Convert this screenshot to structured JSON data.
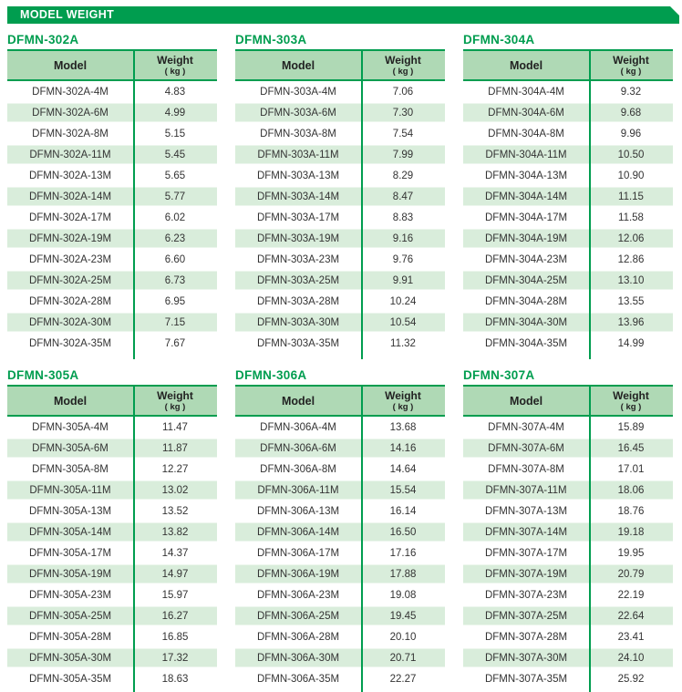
{
  "header": {
    "title": "MODEL WEIGHT"
  },
  "columns": {
    "model": "Model",
    "weight": "Weight",
    "weight_unit": "( kg )"
  },
  "colors": {
    "green": "#009D4F",
    "header_bg": "#AFD9B5",
    "row_alt": "#D9EDDB",
    "text": "#333333"
  },
  "tables": [
    {
      "title": "DFMN-302A",
      "rows": [
        {
          "model": "DFMN-302A-4M",
          "weight": "4.83"
        },
        {
          "model": "DFMN-302A-6M",
          "weight": "4.99"
        },
        {
          "model": "DFMN-302A-8M",
          "weight": "5.15"
        },
        {
          "model": "DFMN-302A-11M",
          "weight": "5.45"
        },
        {
          "model": "DFMN-302A-13M",
          "weight": "5.65"
        },
        {
          "model": "DFMN-302A-14M",
          "weight": "5.77"
        },
        {
          "model": "DFMN-302A-17M",
          "weight": "6.02"
        },
        {
          "model": "DFMN-302A-19M",
          "weight": "6.23"
        },
        {
          "model": "DFMN-302A-23M",
          "weight": "6.60"
        },
        {
          "model": "DFMN-302A-25M",
          "weight": "6.73"
        },
        {
          "model": "DFMN-302A-28M",
          "weight": "6.95"
        },
        {
          "model": "DFMN-302A-30M",
          "weight": "7.15"
        },
        {
          "model": "DFMN-302A-35M",
          "weight": "7.67"
        }
      ]
    },
    {
      "title": "DFMN-303A",
      "rows": [
        {
          "model": "DFMN-303A-4M",
          "weight": "7.06"
        },
        {
          "model": "DFMN-303A-6M",
          "weight": "7.30"
        },
        {
          "model": "DFMN-303A-8M",
          "weight": "7.54"
        },
        {
          "model": "DFMN-303A-11M",
          "weight": "7.99"
        },
        {
          "model": "DFMN-303A-13M",
          "weight": "8.29"
        },
        {
          "model": "DFMN-303A-14M",
          "weight": "8.47"
        },
        {
          "model": "DFMN-303A-17M",
          "weight": "8.83"
        },
        {
          "model": "DFMN-303A-19M",
          "weight": "9.16"
        },
        {
          "model": "DFMN-303A-23M",
          "weight": "9.76"
        },
        {
          "model": "DFMN-303A-25M",
          "weight": "9.91"
        },
        {
          "model": "DFMN-303A-28M",
          "weight": "10.24"
        },
        {
          "model": "DFMN-303A-30M",
          "weight": "10.54"
        },
        {
          "model": "DFMN-303A-35M",
          "weight": "11.32"
        }
      ]
    },
    {
      "title": "DFMN-304A",
      "rows": [
        {
          "model": "DFMN-304A-4M",
          "weight": "9.32"
        },
        {
          "model": "DFMN-304A-6M",
          "weight": "9.68"
        },
        {
          "model": "DFMN-304A-8M",
          "weight": "9.96"
        },
        {
          "model": "DFMN-304A-11M",
          "weight": "10.50"
        },
        {
          "model": "DFMN-304A-13M",
          "weight": "10.90"
        },
        {
          "model": "DFMN-304A-14M",
          "weight": "11.15"
        },
        {
          "model": "DFMN-304A-17M",
          "weight": "11.58"
        },
        {
          "model": "DFMN-304A-19M",
          "weight": "12.06"
        },
        {
          "model": "DFMN-304A-23M",
          "weight": "12.86"
        },
        {
          "model": "DFMN-304A-25M",
          "weight": "13.10"
        },
        {
          "model": "DFMN-304A-28M",
          "weight": "13.55"
        },
        {
          "model": "DFMN-304A-30M",
          "weight": "13.96"
        },
        {
          "model": "DFMN-304A-35M",
          "weight": "14.99"
        }
      ]
    },
    {
      "title": "DFMN-305A",
      "rows": [
        {
          "model": "DFMN-305A-4M",
          "weight": "11.47"
        },
        {
          "model": "DFMN-305A-6M",
          "weight": "11.87"
        },
        {
          "model": "DFMN-305A-8M",
          "weight": "12.27"
        },
        {
          "model": "DFMN-305A-11M",
          "weight": "13.02"
        },
        {
          "model": "DFMN-305A-13M",
          "weight": "13.52"
        },
        {
          "model": "DFMN-305A-14M",
          "weight": "13.82"
        },
        {
          "model": "DFMN-305A-17M",
          "weight": "14.37"
        },
        {
          "model": "DFMN-305A-19M",
          "weight": "14.97"
        },
        {
          "model": "DFMN-305A-23M",
          "weight": "15.97"
        },
        {
          "model": "DFMN-305A-25M",
          "weight": "16.27"
        },
        {
          "model": "DFMN-305A-28M",
          "weight": "16.85"
        },
        {
          "model": "DFMN-305A-30M",
          "weight": "17.32"
        },
        {
          "model": "DFMN-305A-35M",
          "weight": "18.63"
        }
      ]
    },
    {
      "title": "DFMN-306A",
      "rows": [
        {
          "model": "DFMN-306A-4M",
          "weight": "13.68"
        },
        {
          "model": "DFMN-306A-6M",
          "weight": "14.16"
        },
        {
          "model": "DFMN-306A-8M",
          "weight": "14.64"
        },
        {
          "model": "DFMN-306A-11M",
          "weight": "15.54"
        },
        {
          "model": "DFMN-306A-13M",
          "weight": "16.14"
        },
        {
          "model": "DFMN-306A-14M",
          "weight": "16.50"
        },
        {
          "model": "DFMN-306A-17M",
          "weight": "17.16"
        },
        {
          "model": "DFMN-306A-19M",
          "weight": "17.88"
        },
        {
          "model": "DFMN-306A-23M",
          "weight": "19.08"
        },
        {
          "model": "DFMN-306A-25M",
          "weight": "19.45"
        },
        {
          "model": "DFMN-306A-28M",
          "weight": "20.10"
        },
        {
          "model": "DFMN-306A-30M",
          "weight": "20.71"
        },
        {
          "model": "DFMN-306A-35M",
          "weight": "22.27"
        }
      ]
    },
    {
      "title": "DFMN-307A",
      "rows": [
        {
          "model": "DFMN-307A-4M",
          "weight": "15.89"
        },
        {
          "model": "DFMN-307A-6M",
          "weight": "16.45"
        },
        {
          "model": "DFMN-307A-8M",
          "weight": "17.01"
        },
        {
          "model": "DFMN-307A-11M",
          "weight": "18.06"
        },
        {
          "model": "DFMN-307A-13M",
          "weight": "18.76"
        },
        {
          "model": "DFMN-307A-14M",
          "weight": "19.18"
        },
        {
          "model": "DFMN-307A-17M",
          "weight": "19.95"
        },
        {
          "model": "DFMN-307A-19M",
          "weight": "20.79"
        },
        {
          "model": "DFMN-307A-23M",
          "weight": "22.19"
        },
        {
          "model": "DFMN-307A-25M",
          "weight": "22.64"
        },
        {
          "model": "DFMN-307A-28M",
          "weight": "23.41"
        },
        {
          "model": "DFMN-307A-30M",
          "weight": "24.10"
        },
        {
          "model": "DFMN-307A-35M",
          "weight": "25.92"
        }
      ]
    }
  ]
}
